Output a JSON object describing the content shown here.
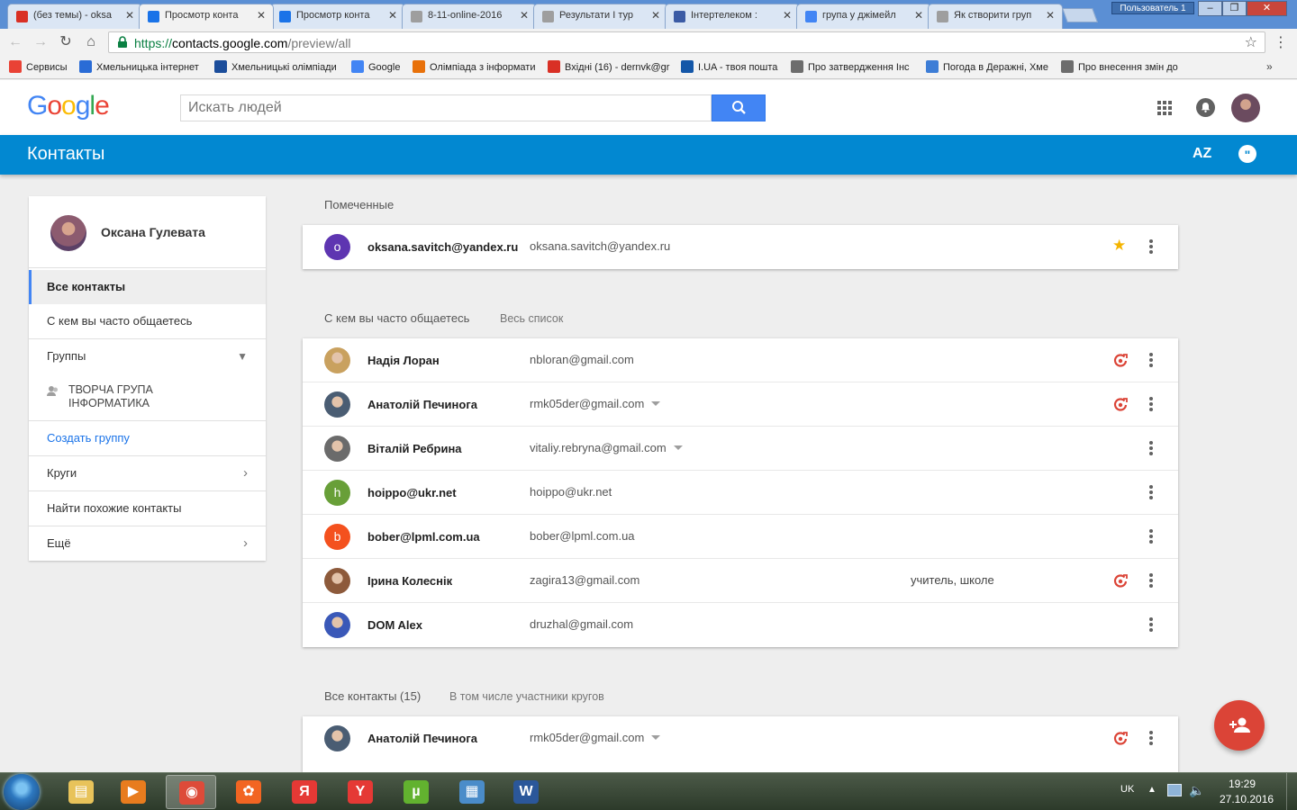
{
  "browser": {
    "tabs": [
      {
        "title": "(без темы) - oksa",
        "icon": "gmail-icon",
        "color": "#d93025",
        "active": false
      },
      {
        "title": "Просмотр конта",
        "icon": "contacts-icon",
        "color": "#1a73e8",
        "active": true
      },
      {
        "title": "Просмотр конта",
        "icon": "contacts-icon",
        "color": "#1a73e8",
        "active": false
      },
      {
        "title": "8-11-online-2016",
        "icon": "document-icon",
        "color": "#9e9e9e",
        "active": false
      },
      {
        "title": "Результати I тур",
        "icon": "document-icon",
        "color": "#9e9e9e",
        "active": false
      },
      {
        "title": "Інтертелеком :",
        "icon": "intertelecom-icon",
        "color": "#3b5ba5",
        "active": false
      },
      {
        "title": "група у джімейл",
        "icon": "google-icon",
        "color": "#4285f4",
        "active": false
      },
      {
        "title": "Як створити груп",
        "icon": "document-icon",
        "color": "#9e9e9e",
        "active": false
      }
    ],
    "user_label": "Пользователь 1",
    "url_scheme": "https://",
    "url_host": "contacts.google.com",
    "url_path": "/preview/all",
    "bookmarks": [
      {
        "label": "Сервисы",
        "icon": "apps-grid-icon",
        "color": "#e94235"
      },
      {
        "label": "Хмельницька інтернет",
        "icon": "zoj-icon",
        "color": "#2a6cd6"
      },
      {
        "label": "Хмельницькі олімпіади",
        "icon": "ooh-icon",
        "color": "#1b4d9b"
      },
      {
        "label": "Google",
        "icon": "google-icon",
        "color": "#4285f4"
      },
      {
        "label": "Олімпіада з інформати",
        "icon": "flower-icon",
        "color": "#e8710a"
      },
      {
        "label": "Вхідні (16) - dernvk@gr",
        "icon": "gmail-icon",
        "color": "#d93025"
      },
      {
        "label": "I.UA - твоя пошта",
        "icon": "iua-icon",
        "color": "#1457a8"
      },
      {
        "label": "Про затвердження Інс",
        "icon": "building-icon",
        "color": "#6d6d6d"
      },
      {
        "label": "Погода в Деражні, Хме",
        "icon": "weather-icon",
        "color": "#3d7dd6"
      },
      {
        "label": "Про внесення змін до",
        "icon": "building-icon",
        "color": "#6d6d6d"
      }
    ],
    "bookmarks_more": "»"
  },
  "header": {
    "logo": "Google",
    "search_placeholder": "Искать людей",
    "app_title": "Контакты",
    "sort_label": "AZ"
  },
  "sidebar": {
    "profile_name": "Оксана Гулевата",
    "items": {
      "all": "Все контакты",
      "frequent": "С кем вы часто общаетесь",
      "groups": "Группы",
      "group1": "ТВОРЧА ГРУПА ІНФОРМАТИКА",
      "create_group": "Создать группу",
      "circles": "Круги",
      "similar": "Найти похожие контакты",
      "more": "Ещё"
    }
  },
  "starred": {
    "title": "Помеченные",
    "contacts": [
      {
        "initial": "o",
        "name": "oksana.savitch@yandex.ru",
        "email": "oksana.savitch@yandex.ru",
        "avatar_color": "#5e35b1",
        "starred": true
      }
    ]
  },
  "frequent": {
    "title": "С кем вы часто общаетесь",
    "link": "Весь список",
    "contacts": [
      {
        "initial": "",
        "name": "Надія Лоран",
        "email": "nbloran@gmail.com",
        "avatar_color": "#c9a15f",
        "circle": true
      },
      {
        "initial": "",
        "name": "Анатолій Печинога",
        "email": "rmk05der@gmail.com",
        "avatar_color": "#4a5d73",
        "circle": true,
        "dropdown": true
      },
      {
        "initial": "",
        "name": "Віталій Ребрина",
        "email": "vitaliy.rebryna@gmail.com",
        "avatar_color": "#6b6b6b",
        "dropdown": true
      },
      {
        "initial": "h",
        "name": "hoippo@ukr.net",
        "email": "hoippo@ukr.net",
        "avatar_color": "#689f38"
      },
      {
        "initial": "b",
        "name": "bober@lpml.com.ua",
        "email": "bober@lpml.com.ua",
        "avatar_color": "#f4511e"
      },
      {
        "initial": "",
        "name": "Ірина Колеснік",
        "email": "zagira13@gmail.com",
        "note": "учитель, школе",
        "avatar_color": "#8d5a3b",
        "circle": true
      },
      {
        "initial": "",
        "name": "DOM Alex",
        "email": "druzhal@gmail.com",
        "avatar_color": "#3a58b8"
      }
    ]
  },
  "all_contacts": {
    "title": "Все контакты (15)",
    "subtitle": "В том числе участники кругов",
    "contacts": [
      {
        "initial": "",
        "name": "Анатолій Печинога",
        "email": "rmk05der@gmail.com",
        "avatar_color": "#4a5d73",
        "circle": true,
        "dropdown": true
      }
    ]
  },
  "taskbar": {
    "lang": "UK",
    "time": "19:29",
    "date": "27.10.2016",
    "apps": [
      {
        "name": "explorer-icon",
        "color": "#e8c35a",
        "glyph": "▤"
      },
      {
        "name": "media-player-icon",
        "color": "#e87c1e",
        "glyph": "▶"
      },
      {
        "name": "chrome-icon",
        "color": "#dd4b39",
        "glyph": "◉",
        "active": true
      },
      {
        "name": "game-icon",
        "color": "#f26522",
        "glyph": "✿"
      },
      {
        "name": "yandex-icon",
        "color": "#e53935",
        "glyph": "Я"
      },
      {
        "name": "yandex-browser-icon",
        "color": "#e53935",
        "glyph": "Y"
      },
      {
        "name": "utorrent-icon",
        "color": "#62b22f",
        "glyph": "µ"
      },
      {
        "name": "network-monitor-icon",
        "color": "#4a8cc9",
        "glyph": "▦"
      },
      {
        "name": "word-icon",
        "color": "#2b579a",
        "glyph": "W"
      }
    ]
  }
}
